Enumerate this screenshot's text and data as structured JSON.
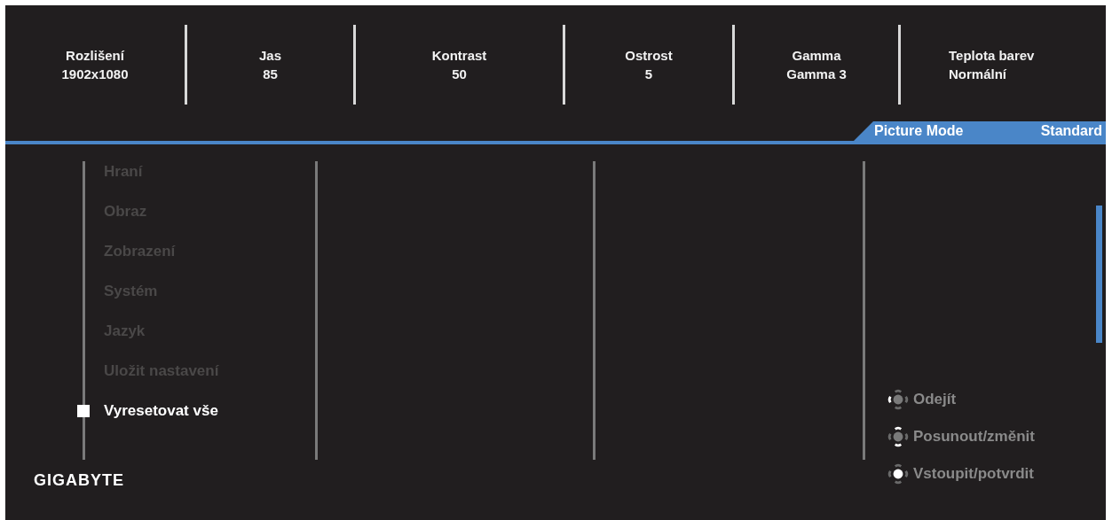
{
  "info_bar": [
    {
      "label": "Rozlišení",
      "value": "1902x1080"
    },
    {
      "label": "Jas",
      "value": "85"
    },
    {
      "label": "Kontrast",
      "value": "50"
    },
    {
      "label": "Ostrost",
      "value": "5"
    },
    {
      "label": "Gamma",
      "value": "Gamma 3"
    },
    {
      "label": "Teplota barev",
      "value": "Normální"
    }
  ],
  "picture_mode": {
    "label": "Picture Mode",
    "value": "Standard"
  },
  "menu": {
    "items": [
      {
        "label": "Hraní",
        "selected": false
      },
      {
        "label": "Obraz",
        "selected": false
      },
      {
        "label": "Zobrazení",
        "selected": false
      },
      {
        "label": "Systém",
        "selected": false
      },
      {
        "label": "Jazyk",
        "selected": false
      },
      {
        "label": "Uložit nastavení",
        "selected": false
      },
      {
        "label": "Vyresetovat vše",
        "selected": true
      }
    ]
  },
  "hints": [
    {
      "kind": "left",
      "label": "Odejít"
    },
    {
      "kind": "vertical",
      "label": "Posunout/změnit"
    },
    {
      "kind": "center",
      "label": "Vstoupit/potvrdit"
    }
  ],
  "logo": "GIGABYTE"
}
